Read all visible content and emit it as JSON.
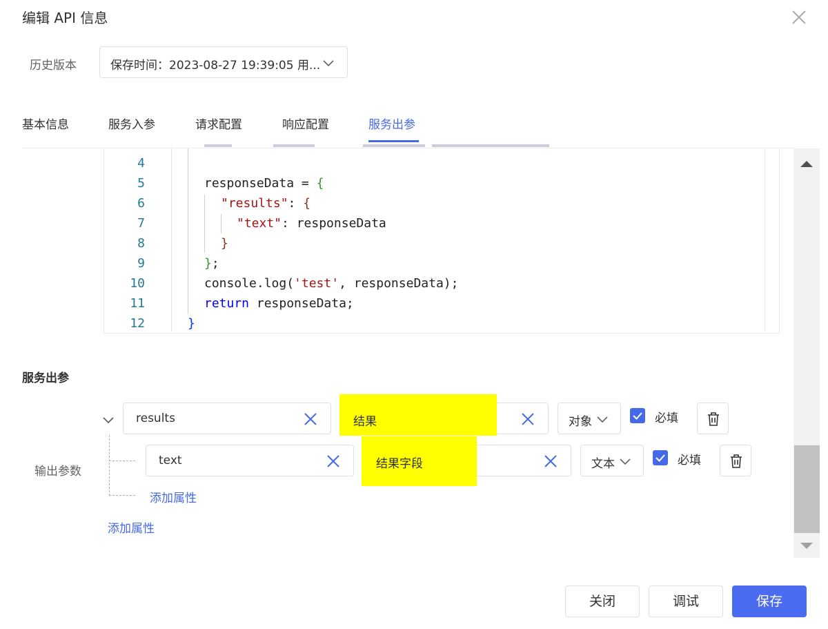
{
  "dialog": {
    "title": "编辑 API 信息"
  },
  "history": {
    "label": "历史版本",
    "selected": "保存时间：2023-08-27 19:39:05 用..."
  },
  "tabs": [
    {
      "label": "基本信息"
    },
    {
      "label": "服务入参"
    },
    {
      "label": "请求配置"
    },
    {
      "label": "响应配置"
    },
    {
      "label": "服务出参",
      "active": true
    }
  ],
  "editor": {
    "lines": [
      {
        "n": "4"
      },
      {
        "n": "5"
      },
      {
        "n": "6"
      },
      {
        "n": "7"
      },
      {
        "n": "8"
      },
      {
        "n": "9"
      },
      {
        "n": "10"
      },
      {
        "n": "11"
      },
      {
        "n": "12"
      }
    ],
    "code": {
      "l5_a": "responseData = ",
      "l5_b": "{",
      "l6_a": "\"results\"",
      "l6_b": ": ",
      "l6_c": "{",
      "l7_a": "\"text\"",
      "l7_b": ": responseData",
      "l8": "}",
      "l9_a": "}",
      "l9_b": ";",
      "l10_a": "console.log(",
      "l10_b": "'test'",
      "l10_c": ", responseData);",
      "l11_a": "return",
      "l11_b": " responseData;",
      "l12": "}"
    }
  },
  "output": {
    "section_title": "服务出参",
    "label": "输出参数",
    "rows": [
      {
        "name": "results",
        "desc": "结果",
        "type": "对象",
        "required_label": "必填",
        "required": true
      },
      {
        "name": "text",
        "desc": "结果字段",
        "type": "文本",
        "required_label": "必填",
        "required": true
      }
    ],
    "add_child": "添加属性",
    "add_root": "添加属性"
  },
  "footer": {
    "close": "关闭",
    "debug": "调试",
    "save": "保存"
  },
  "colors": {
    "accent": "#4669e8",
    "highlight": "#ffff00",
    "primary_button": "#4b6cf0"
  }
}
